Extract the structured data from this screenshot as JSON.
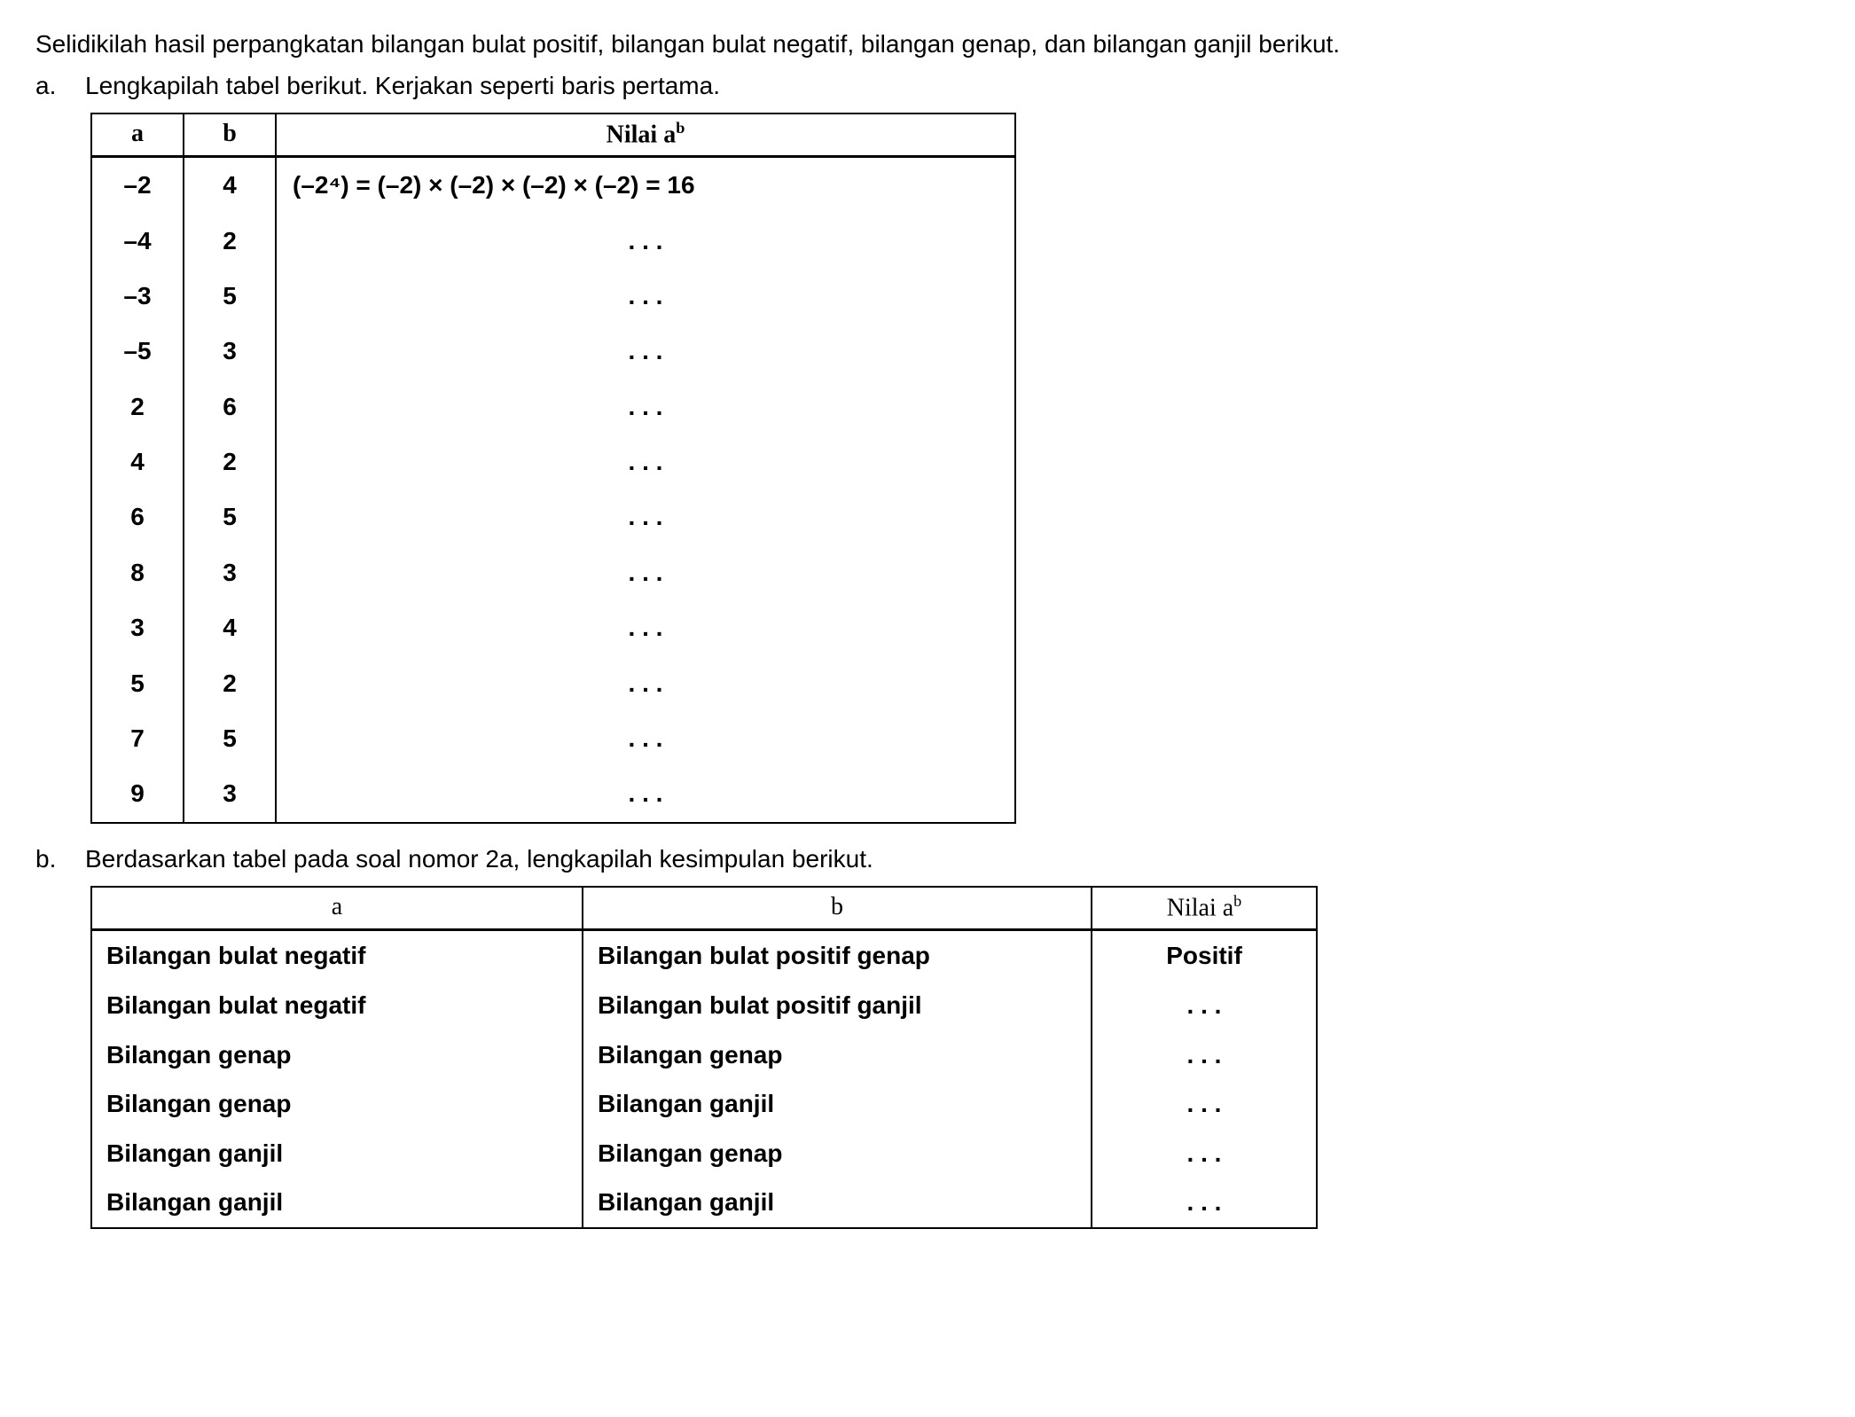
{
  "intro": "Selidikilah hasil perpangkatan bilangan bulat positif, bilangan bulat negatif, bilangan genap, dan bilangan ganjil berikut.",
  "items": {
    "a": {
      "label": "a.",
      "text": "Lengkapilah tabel berikut. Kerjakan seperti baris pertama."
    },
    "b": {
      "label": "b.",
      "text": "Berdasarkan tabel pada soal nomor 2a, lengkapilah kesimpulan berikut."
    }
  },
  "table1": {
    "headers": {
      "a": "a",
      "b": "b",
      "c_prefix": "Nilai a",
      "c_sup": "b"
    },
    "rows": [
      {
        "a": "–2",
        "b": "4",
        "c": "(–2⁴) = (–2) × (–2) × (–2) × (–2) = 16",
        "first": true
      },
      {
        "a": "–4",
        "b": "2",
        "c": ". . ."
      },
      {
        "a": "–3",
        "b": "5",
        "c": ". . ."
      },
      {
        "a": "–5",
        "b": "3",
        "c": ". . ."
      },
      {
        "a": "2",
        "b": "6",
        "c": ". . ."
      },
      {
        "a": "4",
        "b": "2",
        "c": ". . ."
      },
      {
        "a": "6",
        "b": "5",
        "c": ". . ."
      },
      {
        "a": "8",
        "b": "3",
        "c": ". . ."
      },
      {
        "a": "3",
        "b": "4",
        "c": ". . ."
      },
      {
        "a": "5",
        "b": "2",
        "c": ". . ."
      },
      {
        "a": "7",
        "b": "5",
        "c": ". . ."
      },
      {
        "a": "9",
        "b": "3",
        "c": ". . ."
      }
    ]
  },
  "table2": {
    "headers": {
      "a": "a",
      "b": "b",
      "c_prefix": "Nilai a",
      "c_sup": "b"
    },
    "rows": [
      {
        "a": "Bilangan bulat negatif",
        "b": "Bilangan bulat positif genap",
        "c": "Positif"
      },
      {
        "a": "Bilangan bulat negatif",
        "b": "Bilangan bulat positif ganjil",
        "c": ". . ."
      },
      {
        "a": "Bilangan genap",
        "b": "Bilangan genap",
        "c": ". . ."
      },
      {
        "a": "Bilangan genap",
        "b": "Bilangan ganjil",
        "c": ". . ."
      },
      {
        "a": "Bilangan ganjil",
        "b": "Bilangan genap",
        "c": ". . ."
      },
      {
        "a": "Bilangan ganjil",
        "b": "Bilangan ganjil",
        "c": ". . ."
      }
    ]
  }
}
